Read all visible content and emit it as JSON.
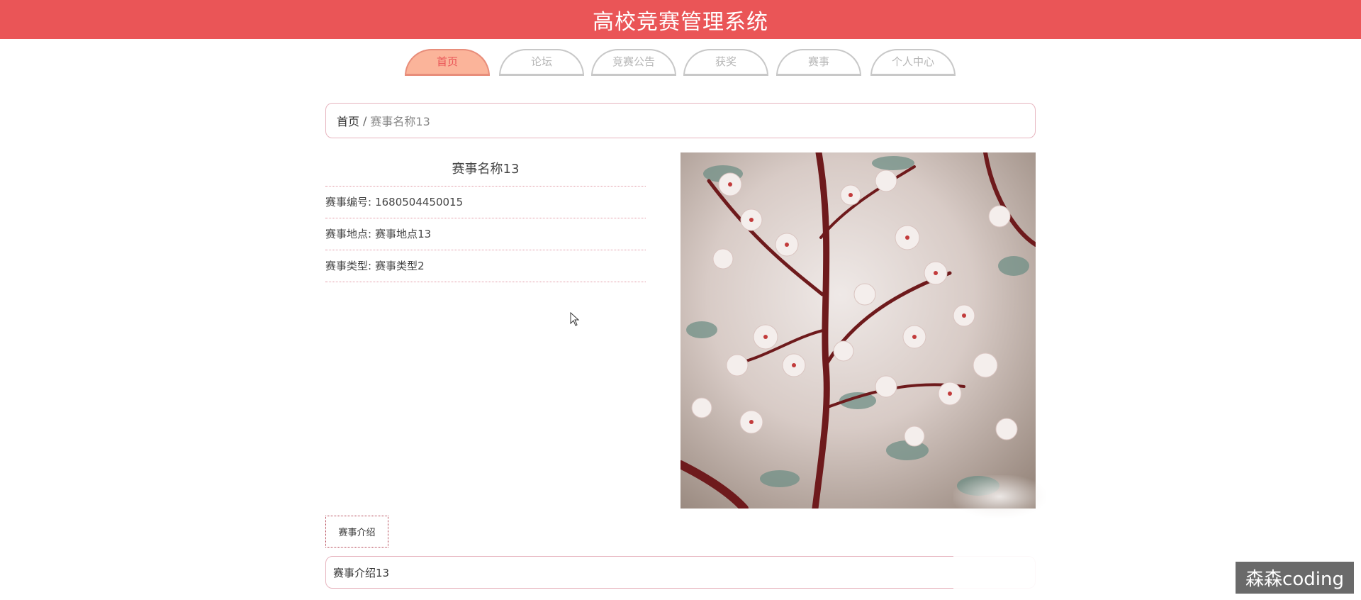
{
  "header": {
    "title": "高校竞赛管理系统"
  },
  "nav": {
    "items": [
      {
        "label": "首页"
      },
      {
        "label": "论坛"
      },
      {
        "label": "竞赛公告"
      },
      {
        "label": "获奖"
      },
      {
        "label": "赛事"
      },
      {
        "label": "个人中心"
      }
    ],
    "active": "首页"
  },
  "breadcrumb": {
    "home": "首页",
    "separator": "/",
    "current": "赛事名称13"
  },
  "detail": {
    "title": "赛事名称13",
    "fields": [
      {
        "label": "赛事编号:",
        "value": "1680504450015"
      },
      {
        "label": "赛事地点:",
        "value": "赛事地点13"
      },
      {
        "label": "赛事类型:",
        "value": "赛事类型2"
      }
    ]
  },
  "photo": {
    "subject": "cherry-blossom-branch"
  },
  "intro": {
    "tab_label": "赛事介绍",
    "content": "赛事介绍13"
  },
  "watermark": {
    "text": "森森coding"
  },
  "colors": {
    "header_bg": "#ea5557",
    "nav_active_bg": "#fbb49a",
    "border_pink": "#e7b5bf"
  }
}
